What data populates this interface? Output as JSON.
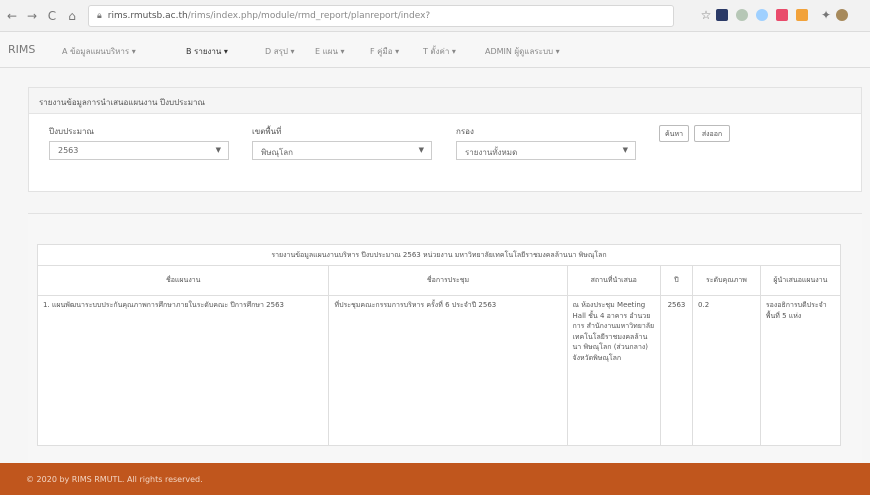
{
  "browser": {
    "url_host": "rims.rmutsb.ac.th",
    "url_path": "/rims/index.php/module/rmd_report/planreport/index?"
  },
  "navbar": {
    "brand": "RIMS",
    "menu": [
      {
        "label": "A ข้อมูลแผนบริหาร ▾",
        "active": false
      },
      {
        "label": "B รายงาน ▾",
        "active": true
      },
      {
        "label": "D สรุป ▾",
        "active": false
      },
      {
        "label": "E แผน ▾",
        "active": false
      },
      {
        "label": "F คู่มือ ▾",
        "active": false
      },
      {
        "label": "T ตั้งค่า ▾",
        "active": false
      },
      {
        "label": "ADMIN ผู้ดูแลระบบ ▾",
        "active": false
      }
    ]
  },
  "search_panel": {
    "title": "รายงานข้อมูลการนำเสนอแผนงาน ปีงบประมาณ",
    "fields": {
      "year": {
        "label": "ปีงบประมาณ",
        "value": "2563"
      },
      "area": {
        "label": "เขตพื้นที่",
        "value": "พิษณุโลก"
      },
      "filter": {
        "label": "กรอง",
        "value": "รายงานทั้งหมด"
      }
    },
    "buttons": {
      "search": "ค้นหา",
      "export": "ส่งออก"
    }
  },
  "results": {
    "caption": "รายงานข้อมูลแผนงานบริหาร ปีงบประมาณ 2563 หน่วยงาน มหาวิทยาลัยเทคโนโลยีราชมงคลล้านนา พิษณุโลก",
    "columns": [
      "ชื่อแผนงาน",
      "ชื่อการประชุม",
      "สถานที่นำเสนอ",
      "ปี",
      "ระดับคุณภาพ",
      "ผู้นำเสนอแผนงาน"
    ],
    "rows": [
      {
        "plan": "1. แผนพัฒนาระบบประกันคุณภาพการศึกษาภายในระดับคณะ ปีการศึกษา 2563",
        "meeting": "ที่ประชุมคณะกรรมการบริหาร ครั้งที่ 6 ประจำปี 2563",
        "place": "ณ ห้องประชุม Meeting Hall ชั้น 4 อาคาร อำนวยการ สำนักงานมหาวิทยาลัยเทคโนโลยีราชมงคลล้านนา พิษณุโลก (ส่วนกลาง) จังหวัดพิษณุโลก",
        "year": "2563",
        "level": "0.2",
        "presenter": "รองอธิการบดีประจำพื้นที่ 5 แห่ง"
      }
    ]
  },
  "footer": {
    "text": "© 2020 by RIMS RMUTL. All rights reserved."
  },
  "colors": {
    "footer_bg": "#c0561d",
    "footer_text": "#f3d5c3"
  }
}
